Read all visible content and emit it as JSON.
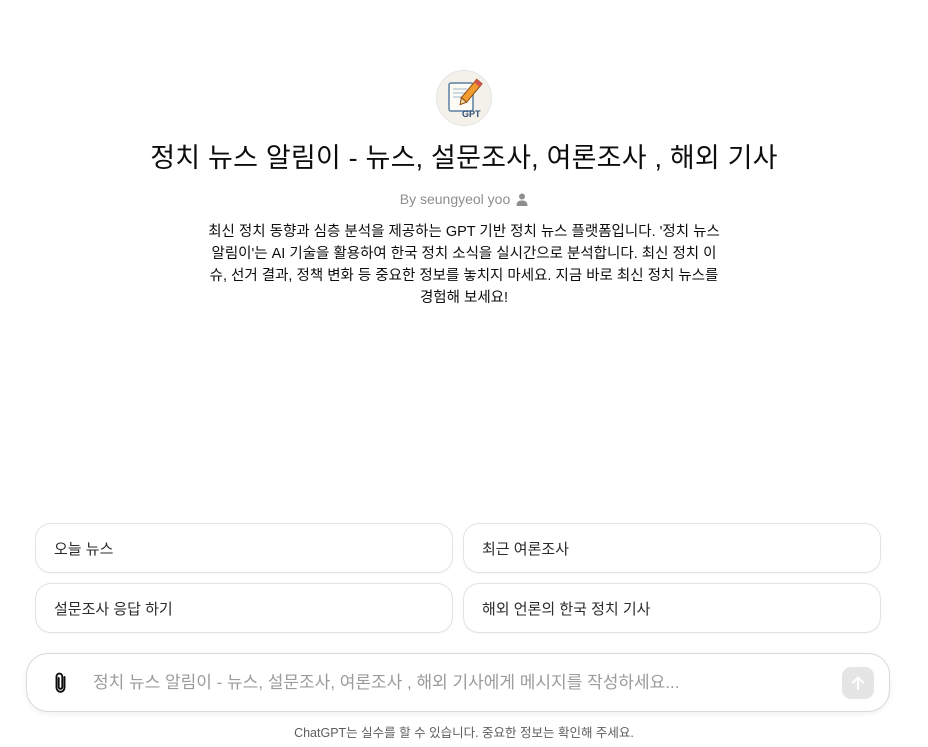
{
  "gpt": {
    "avatar_text": "GPT",
    "title": "정치 뉴스 알림이 - 뉴스, 설문조사, 여론조사 , 해외 기사",
    "byline": "By seungyeol yoo",
    "description": "최신 정치 동향과 심층 분석을 제공하는 GPT 기반 정치 뉴스 플랫폼입니다. '정치 뉴스 알림이'는 AI 기술을 활용하여 한국 정치 소식을 실시간으로 분석합니다. 최신 정치 이슈, 선거 결과, 정책 변화 등 중요한 정보를 놓치지 마세요. 지금 바로 최신 정치 뉴스를 경험해 보세요!"
  },
  "starters": [
    {
      "label": "오늘 뉴스"
    },
    {
      "label": "최근 여론조사"
    },
    {
      "label": "설문조사 응답 하기"
    },
    {
      "label": "해외 언론의 한국 정치 기사"
    }
  ],
  "composer": {
    "placeholder": "정치 뉴스 알림이 - 뉴스, 설문조사, 여론조사 , 해외 기사에게 메시지를 작성하세요...",
    "value": ""
  },
  "footer": {
    "disclaimer": "ChatGPT는 실수를 할 수 있습니다. 중요한 정보는 확인해 주세요."
  },
  "icons": {
    "avatar": "pencil-document-icon",
    "byline": "person-icon",
    "attach": "paperclip-icon",
    "send": "arrow-up-icon"
  },
  "colors": {
    "send_button_disabled": "#e5e5e5",
    "muted_text": "#8e8e8e"
  }
}
